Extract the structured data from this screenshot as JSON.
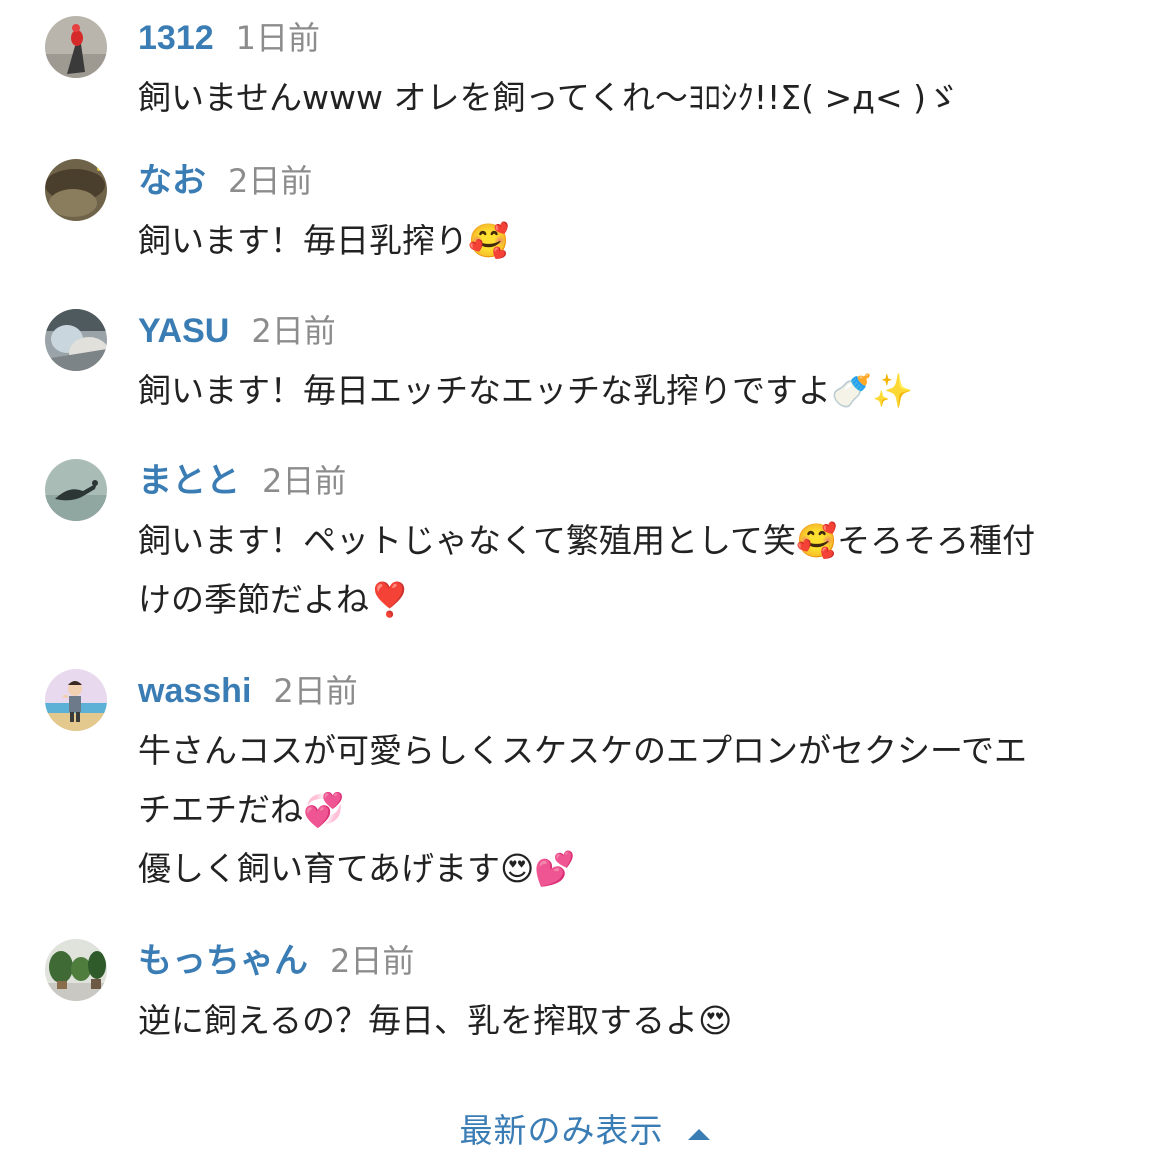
{
  "comments": [
    {
      "author": "1312",
      "time": "1日前",
      "lines": [
        "飼いませんwww オレを飼ってくれ〜ﾖﾛｼｸ!!Σ( >д< )ゞ"
      ],
      "avatar_icon": "red-bird-avatar-icon"
    },
    {
      "author": "なお",
      "time": "2日前",
      "lines": [
        "飼います！毎日乳搾り🥰"
      ],
      "avatar_icon": "brown-hat-avatar-icon"
    },
    {
      "author": "YASU",
      "time": "2日前",
      "lines": [
        "飼います！毎日エッチなエッチな乳搾りですよ🍼✨"
      ],
      "avatar_icon": "person-photo-avatar-icon"
    },
    {
      "author": "まとと",
      "time": "2日前",
      "lines": [
        "飼います！ペットじゃなくて繁殖用として笑🥰そろそろ種付",
        "けの季節だよね❣️"
      ],
      "avatar_icon": "bird-on-water-avatar-icon"
    },
    {
      "author": "wasshi",
      "time": "2日前",
      "lines": [
        "牛さんコスが可愛らしくスケスケのエプロンがセクシーでエ",
        "チエチだね💞",
        "優しく飼い育てあげます😍💕"
      ],
      "avatar_icon": "beach-character-avatar-icon"
    },
    {
      "author": "もっちゃん",
      "time": "2日前",
      "lines": [
        "逆に飼えるの？毎日、乳を搾取するよ😍"
      ],
      "avatar_icon": "plants-avatar-icon"
    }
  ],
  "show_latest": {
    "label": "最新のみ表示"
  },
  "colors": {
    "author": "#3a7cb4",
    "time": "#8c8c8c",
    "text": "#222222",
    "link": "#3a7cb4"
  }
}
